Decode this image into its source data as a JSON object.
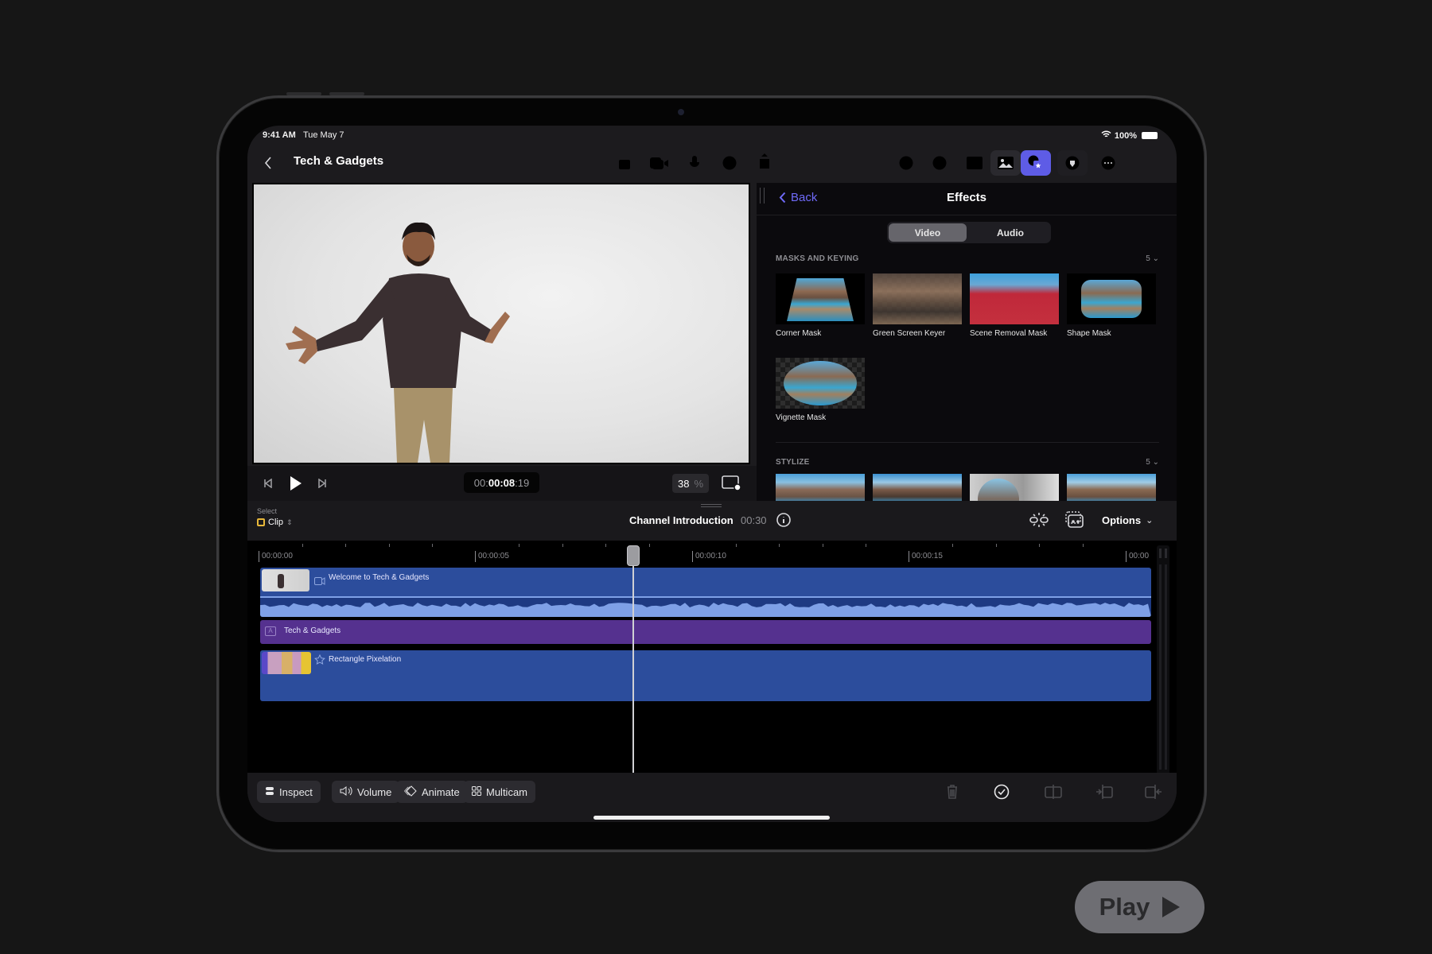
{
  "status_bar": {
    "time": "9:41 AM",
    "date": "Tue May 7",
    "battery": "100%"
  },
  "nav": {
    "title": "Tech & Gadgets",
    "left_icons": [
      "import-icon",
      "camera-icon",
      "microphone-icon",
      "voiceover-icon",
      "share-icon"
    ],
    "right_icons": [
      "undo-icon",
      "redo-icon",
      "titles-icon",
      "photos-icon",
      "effects-icon",
      "live-drawing-icon",
      "more-icon"
    ],
    "active_icon": "effects-icon",
    "accent": "#5e5ce6"
  },
  "viewer": {
    "timecode_prefix": "00:",
    "timecode_main": "00:08",
    "timecode_suffix": ":19",
    "zoom_value": "38",
    "zoom_unit": "%"
  },
  "effects_panel": {
    "back_label": "Back",
    "title": "Effects",
    "tabs": [
      {
        "label": "Video",
        "active": true
      },
      {
        "label": "Audio",
        "active": false
      }
    ],
    "sections": [
      {
        "title": "MASKS AND KEYING",
        "count": "5",
        "items": [
          {
            "label": "Corner Mask"
          },
          {
            "label": "Green Screen Keyer"
          },
          {
            "label": "Scene Removal Mask"
          },
          {
            "label": "Shape Mask"
          },
          {
            "label": "Vignette Mask"
          }
        ]
      },
      {
        "title": "STYLIZE",
        "count": "5",
        "items": [
          {
            "label": ""
          },
          {
            "label": ""
          },
          {
            "label": ""
          },
          {
            "label": ""
          }
        ]
      }
    ]
  },
  "timeline": {
    "select_label": "Select",
    "select_value": "Clip",
    "project_name": "Channel Introduction",
    "project_duration": "00:30",
    "options_label": "Options",
    "ruler_labels": [
      "00:00:00",
      "00:00:05",
      "00:00:10",
      "00:00:15",
      "00:00"
    ],
    "playhead_time": "00:00:08:19",
    "clips": [
      {
        "type": "video",
        "label": "Welcome to Tech & Gadgets",
        "color": "#2c4d9c"
      },
      {
        "type": "title",
        "label": "Tech & Gadgets",
        "color": "#55318f"
      },
      {
        "type": "effect",
        "label": "Rectangle Pixelation",
        "color": "#2c4d9c"
      }
    ]
  },
  "bottom_toolbar": {
    "buttons": [
      {
        "label": "Inspect",
        "icon": "inspect-icon"
      },
      {
        "label": "Volume",
        "icon": "volume-icon"
      },
      {
        "label": "Animate",
        "icon": "animate-icon"
      },
      {
        "label": "Multicam",
        "icon": "multicam-icon"
      }
    ],
    "right_icons": [
      "delete-icon",
      "done-icon",
      "split-icon",
      "trim-start-icon",
      "trim-end-icon"
    ]
  },
  "cta": {
    "label": "Play"
  }
}
